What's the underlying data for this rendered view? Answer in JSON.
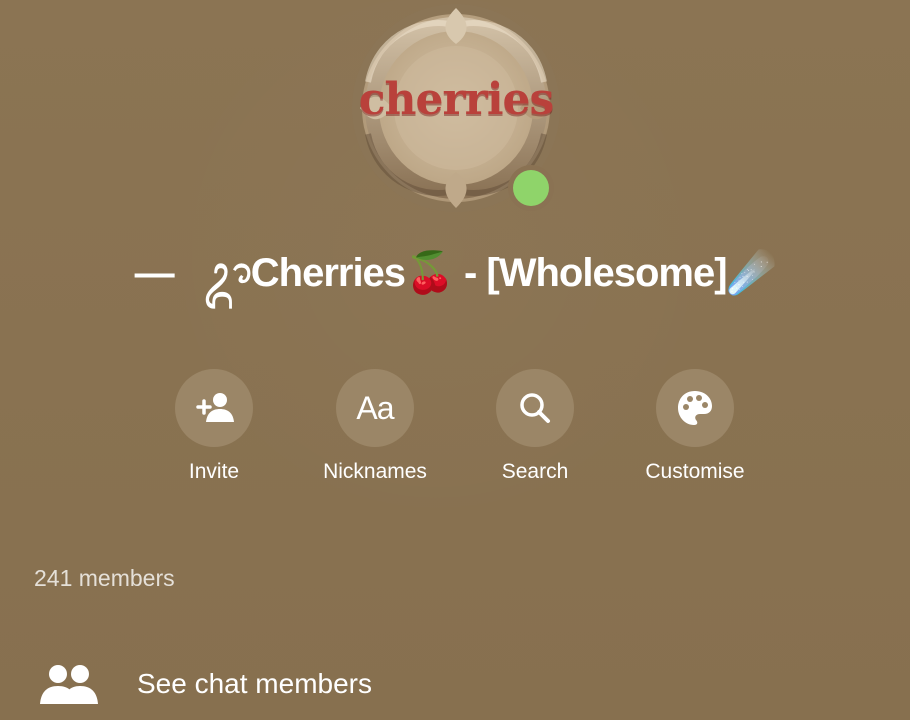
{
  "chat": {
    "title": "—⠀ᬊCherries🍒 - [Wholesome]☄️",
    "avatar_text": "cherries",
    "status": "online"
  },
  "actions": [
    {
      "label": "Invite",
      "icon": "add-person-icon"
    },
    {
      "label": "Nicknames",
      "icon": "aa-text-icon",
      "glyph": "Aa"
    },
    {
      "label": "Search",
      "icon": "search-icon"
    },
    {
      "label": "Customise",
      "icon": "palette-icon"
    }
  ],
  "members": {
    "count_label": "241 members",
    "see_label": "See chat members",
    "icon": "people-icon"
  },
  "colors": {
    "background": "#8a7253",
    "online": "#8fd46a",
    "button_bg": "#9b8667"
  }
}
